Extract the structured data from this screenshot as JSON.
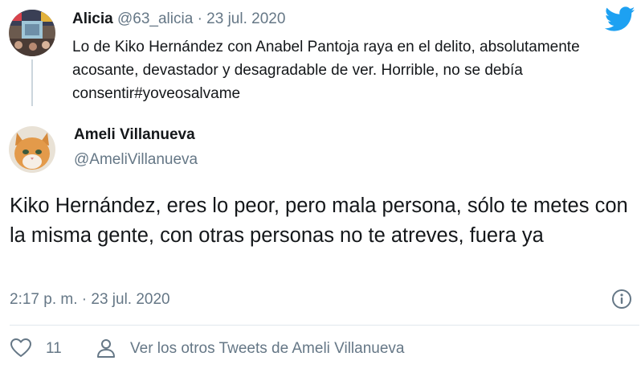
{
  "reply": {
    "name": "Alicia",
    "handle": "@63_alicia",
    "separator": "·",
    "date": "23 jul. 2020",
    "text": "Lo de Kiko Hernández con Anabel Pantoja raya en el delito, absolutamente acosante, devastador y desagradable de ver. Horrible, no se debía consentir#yoveosalvame"
  },
  "tweet": {
    "author_name": "Ameli Villanueva",
    "author_handle": "@AmeliVillanueva",
    "text": "Kiko Hernández, eres lo peor, pero  mala persona, sólo te metes con la misma gente, con otras personas no te atreves, fuera ya",
    "timestamp": "2:17 p. m. · 23 jul. 2020"
  },
  "actions": {
    "like_count": "11",
    "more_tweets_label": "Ver los otros Tweets de Ameli Villanueva"
  },
  "icons": {
    "brand": "twitter-bird-icon",
    "info": "info-icon",
    "like": "heart-icon",
    "profile": "person-icon"
  },
  "colors": {
    "text": "#14171a",
    "secondary": "#657786",
    "brand": "#1da1f2",
    "divider": "#e1e8ed",
    "thread_line": "#ccd6dd"
  }
}
